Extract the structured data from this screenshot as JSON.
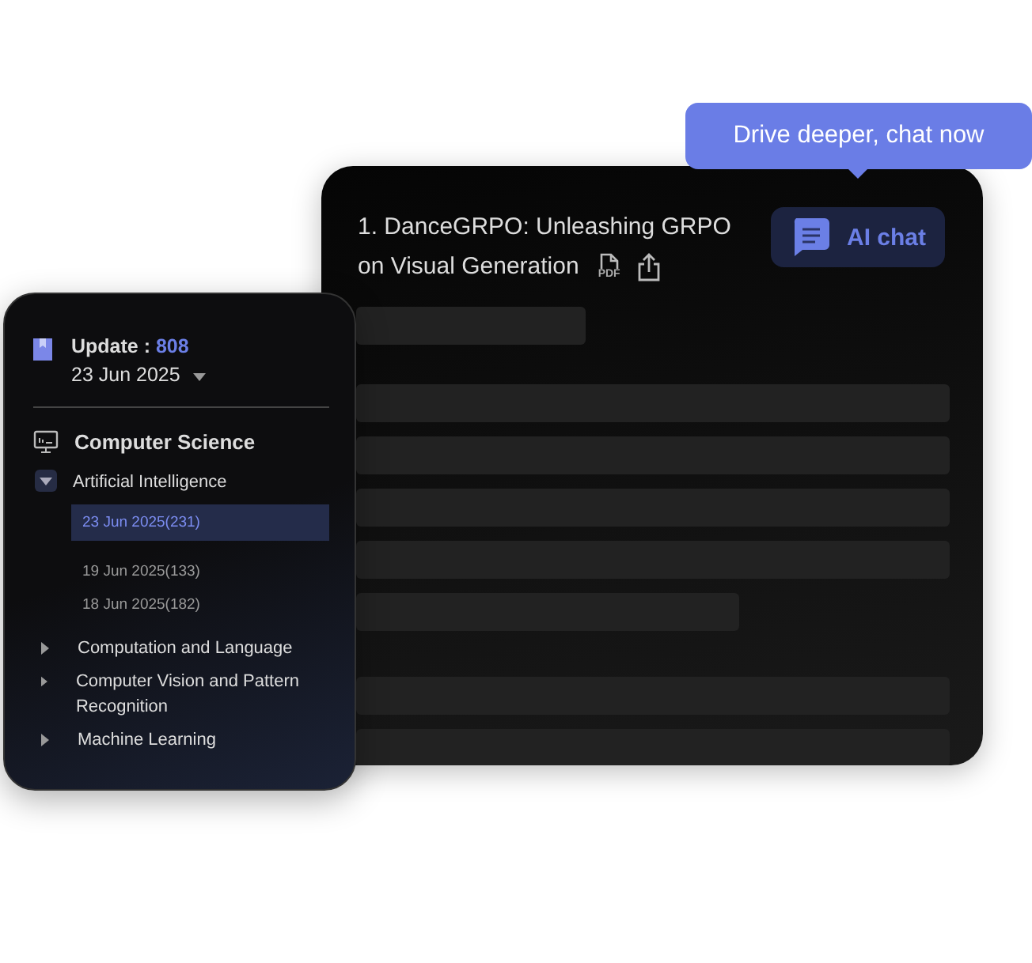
{
  "tooltip": {
    "text": "Drive deeper, chat now"
  },
  "paper": {
    "title_lines": [
      "1. DanceGRPO: Unleashing GRPO",
      "on Visual Generation"
    ],
    "pdf_icon_text": "PDF",
    "ai_chat": "AI chat"
  },
  "sidebar": {
    "update_label": "Update :",
    "update_count": "808",
    "date": "23 Jun 2025",
    "category": "Computer Science",
    "tree": [
      {
        "label": "Artificial Intelligence",
        "expanded": true,
        "children": [
          {
            "label": "23 Jun 2025(231)",
            "selected": true
          },
          {
            "label": "19 Jun 2025(133)",
            "selected": false
          },
          {
            "label": "18 Jun 2025(182)",
            "selected": false
          }
        ]
      },
      {
        "label": "Computation and Language",
        "expanded": false
      },
      {
        "label": "Computer Vision and Pattern Recognition",
        "expanded": false
      },
      {
        "label": "Machine Learning",
        "expanded": false
      }
    ]
  }
}
